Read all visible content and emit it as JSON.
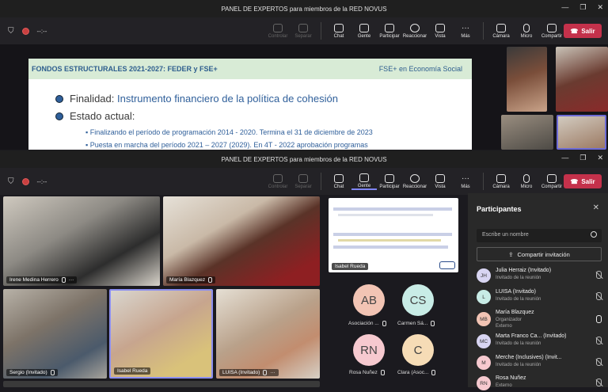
{
  "top_window": {
    "title": "PANEL DE EXPERTOS para miembros de la RED NOVUS",
    "timer": "--:--",
    "slide": {
      "header_left": "FONDOS ESTRUCTURALES 2021-2027: FEDER y FSE+",
      "header_right": "FSE+ en Economía Social",
      "finalidad_label": "Finalidad:",
      "finalidad_text": "Instrumento financiero de la política de cohesión",
      "estado_label": "Estado actual:",
      "sub1_a": "Finalizando el período de programación 2014 - 2020.",
      "sub1_b": "Termina el 31 de diciembre de 2023",
      "sub2": "Puesta en marcha del período 2021 – 2027 (2029). En 4T - 2022 aprobación programas"
    }
  },
  "bottom_window": {
    "title": "PANEL DE EXPERTOS para miembros de la RED NOVUS",
    "timer": "--:--"
  },
  "toolbar": {
    "controlar": "Controlar",
    "separar": "Separar",
    "chat": "Chat",
    "gente": "Gente",
    "participar": "Participar",
    "reaccionar": "Reaccionar",
    "vista": "Vista",
    "mas": "Más",
    "camara": "Cámara",
    "micro": "Micro",
    "compartir": "Compartir",
    "salir": "Salir"
  },
  "video_tiles": [
    {
      "name": "Irene Medina Herrero"
    },
    {
      "name": "María Blazquez"
    },
    {
      "name": "Sergio (Invitado)"
    },
    {
      "name": "Isabel Rueda"
    },
    {
      "name": "LUISA (Invitado)"
    }
  ],
  "shared_screen_label": "Isabel Rueda",
  "avatar_tiles": [
    {
      "initials": "AB",
      "name": "Asociación ...",
      "color": "#f2c4b4"
    },
    {
      "initials": "CS",
      "name": "Carmen Sá...",
      "color": "#c8ece6"
    },
    {
      "initials": "RN",
      "name": "Rosa Nuñez",
      "color": "#f6c9cf"
    },
    {
      "initials": "C",
      "name": "Clara (Asoc...",
      "color": "#f6dcb6"
    }
  ],
  "participants_panel": {
    "title": "Participantes",
    "search_placeholder": "Escribe un nombre",
    "share_invite": "Compartir invitación",
    "people": [
      {
        "initials": "JH",
        "name": "Julia Herraiz (Invitado)",
        "role": "Invitado de la reunión",
        "color": "#d8d5f2",
        "mic": "off"
      },
      {
        "initials": "L",
        "name": "LUISA (Invitado)",
        "role": "Invitado de la reunión",
        "color": "#c8ece6",
        "mic": "off"
      },
      {
        "initials": "MB",
        "name": "María Blazquez",
        "role": "Organizador",
        "role2": "Externo",
        "color": "#f2c4b4",
        "mic": "on"
      },
      {
        "initials": "MC",
        "name": "Marta Franco Ca... (Invitado)",
        "role": "Invitado de la reunión",
        "color": "#d8d5f2",
        "mic": "off"
      },
      {
        "initials": "M",
        "name": "Merche (Inclusives) (Invit...",
        "role": "Invitado de la reunión",
        "color": "#f6c9cf",
        "mic": "off"
      },
      {
        "initials": "RN",
        "name": "Rosa Nuñez",
        "role": "Externo",
        "color": "#f6c9cf",
        "mic": "off"
      }
    ]
  }
}
